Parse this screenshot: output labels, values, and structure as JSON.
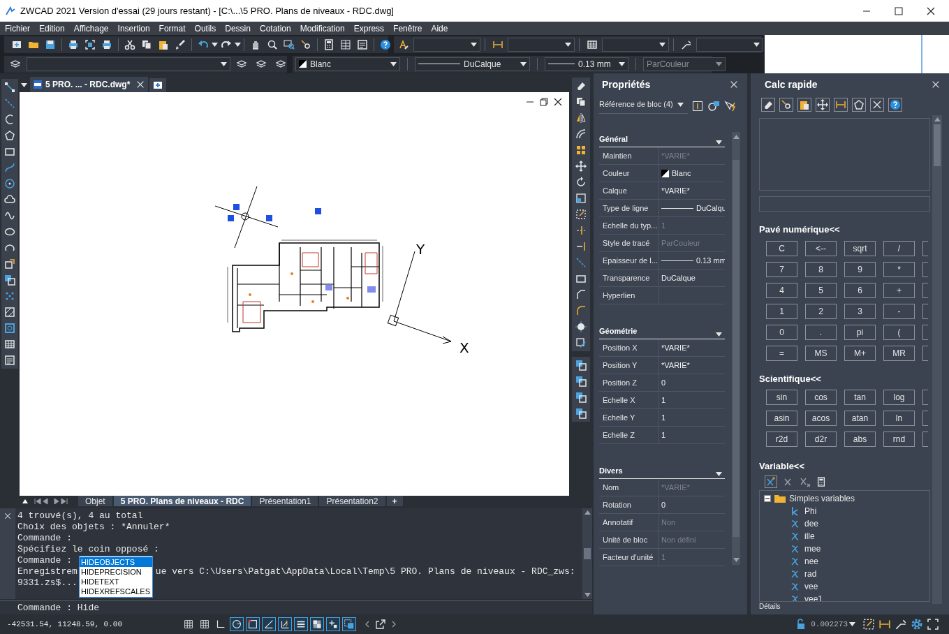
{
  "window": {
    "title": "ZWCAD 2021 Version d'essai (29 jours restant) - [C:\\...\\5 PRO. Plans de niveaux - RDC.dwg]"
  },
  "menu": [
    "Fichier",
    "Edition",
    "Affichage",
    "Insertion",
    "Format",
    "Outils",
    "Dessin",
    "Cotation",
    "Modification",
    "Express",
    "Fenêtre",
    "Aide"
  ],
  "property_toolbar": {
    "pen": "Blanc",
    "linetype": "DuCalque",
    "lineweight": "0.13 mm",
    "plot_style": {
      "value": "ParCouleur",
      "disabled": true
    }
  },
  "document_tabs": [
    {
      "label": "5 PRO. ... - RDC.dwg*",
      "selected": true
    }
  ],
  "drawing": {
    "axis_labels": [
      "Y",
      "X"
    ]
  },
  "layout_tabs": [
    {
      "label": "Objet",
      "selected": false
    },
    {
      "label": "5 PRO. Plans de niveaux - RDC",
      "selected": true
    },
    {
      "label": "Présentation1",
      "selected": false
    },
    {
      "label": "Présentation2",
      "selected": false
    }
  ],
  "new_layout_button": "+",
  "command": {
    "history": [
      {
        "text": "4 trouvé(s), 4 au total"
      },
      {
        "text": "Choix des objets : *Annuler*"
      },
      {
        "text": "Commande :"
      },
      {
        "text": "Spécifiez le coin opposé :"
      },
      {
        "text": "Commande :"
      },
      {
        "text": "Enregistrem",
        "continuation": "ue vers C:\\Users\\Patgat\\AppData\\Local\\Temp\\5 PRO. Plans de niveaux - RDC_zws:"
      },
      {
        "text": "9331.zs$..."
      }
    ],
    "autocomplete": [
      {
        "label": "HIDEOBJECTS",
        "selected": true
      },
      {
        "label": "HIDEPRECISION",
        "selected": false
      },
      {
        "label": "HIDETEXT",
        "selected": false
      },
      {
        "label": "HIDEXREFSCALES",
        "selected": false
      }
    ],
    "prompt": "Commande : Hide"
  },
  "properties": {
    "title": "Propriétés",
    "selection": "Référence de bloc (4)",
    "sections": [
      {
        "title": "Général",
        "expanded": true,
        "rows": [
          {
            "label": "Maintien",
            "value": "*VARIE*",
            "disabled": true,
            "kind": "text"
          },
          {
            "label": "Couleur",
            "value": "Blanc",
            "disabled": false,
            "kind": "color"
          },
          {
            "label": "Calque",
            "value": "*VARIE*",
            "disabled": false,
            "kind": "text"
          },
          {
            "label": "Type de ligne",
            "value": "DuCalqu",
            "disabled": false,
            "kind": "line"
          },
          {
            "label": "Echelle du typ...",
            "value": "1",
            "disabled": true,
            "kind": "text"
          },
          {
            "label": "Style de tracé",
            "value": "ParCouleur",
            "disabled": true,
            "kind": "text"
          },
          {
            "label": "Epaisseur de l...",
            "value": "0.13 mm",
            "disabled": false,
            "kind": "line"
          },
          {
            "label": "Transparence",
            "value": "DuCalque",
            "disabled": false,
            "kind": "text"
          },
          {
            "label": "Hyperlien",
            "kind": "text"
          }
        ]
      },
      {
        "title": "Géométrie",
        "expanded": true,
        "rows": [
          {
            "label": "Position X",
            "value": "*VARIE*",
            "disabled": false,
            "kind": "text"
          },
          {
            "label": "Position Y",
            "value": "*VARIE*",
            "disabled": false,
            "kind": "text"
          },
          {
            "label": "Position Z",
            "value": "0",
            "disabled": false,
            "kind": "text"
          },
          {
            "label": "Echelle X",
            "value": "1",
            "disabled": false,
            "kind": "text"
          },
          {
            "label": "Echelle Y",
            "value": "1",
            "disabled": false,
            "kind": "text"
          },
          {
            "label": "Echelle Z",
            "value": "1",
            "disabled": false,
            "kind": "text"
          }
        ]
      },
      {
        "title": "Divers",
        "expanded": true,
        "rows": [
          {
            "label": "Nom",
            "value": "*VARIE*",
            "disabled": true,
            "kind": "text"
          },
          {
            "label": "Rotation",
            "value": "0",
            "disabled": false,
            "kind": "text"
          },
          {
            "label": "Annotatif",
            "value": "Non",
            "disabled": true,
            "kind": "text"
          },
          {
            "label": "Unité de bloc",
            "value": "Non défini",
            "disabled": true,
            "kind": "text"
          },
          {
            "label": "Facteur d'unité",
            "value": "1",
            "disabled": true,
            "kind": "text"
          }
        ]
      }
    ]
  },
  "calc": {
    "title": "Calc rapide",
    "keypads": [
      {
        "title": "Pavé numérique<<",
        "keys": [
          "C",
          "<--",
          "sqrt",
          "/",
          "7",
          "8",
          "9",
          "*",
          "4",
          "5",
          "6",
          "+",
          "1",
          "2",
          "3",
          "-",
          "0",
          ".",
          "pi",
          "(",
          "=",
          "MS",
          "M+",
          "MR"
        ]
      },
      {
        "title": "Scientifique<<",
        "keys": [
          "sin",
          "cos",
          "tan",
          "log",
          "asin",
          "acos",
          "atan",
          "ln",
          "r2d",
          "d2r",
          "abs",
          "rnd"
        ]
      }
    ],
    "variables": {
      "title": "Variable<<",
      "tree": [
        {
          "label": "Simples variables",
          "expanded": true,
          "children": [
            {
              "label": "Phi",
              "kind": "constant"
            },
            {
              "label": "dee",
              "kind": "function"
            },
            {
              "label": "ille",
              "kind": "function"
            },
            {
              "label": "mee",
              "kind": "function"
            },
            {
              "label": "nee",
              "kind": "function"
            },
            {
              "label": "rad",
              "kind": "function"
            },
            {
              "label": "vee",
              "kind": "function"
            },
            {
              "label": "vee1",
              "kind": "function"
            }
          ]
        }
      ]
    },
    "details_label": "Détails"
  },
  "status_bar": {
    "coordinates": "-42531.54, 11248.59, 0.00",
    "toggles": [
      {
        "on": false
      },
      {
        "on": false
      },
      {
        "on": false
      },
      {
        "on": true
      },
      {
        "on": true
      },
      {
        "on": true
      },
      {
        "on": true
      },
      {
        "on": true
      },
      {
        "on": true
      },
      {
        "on": true
      },
      {
        "on": true
      }
    ],
    "scale": "0.002273"
  }
}
